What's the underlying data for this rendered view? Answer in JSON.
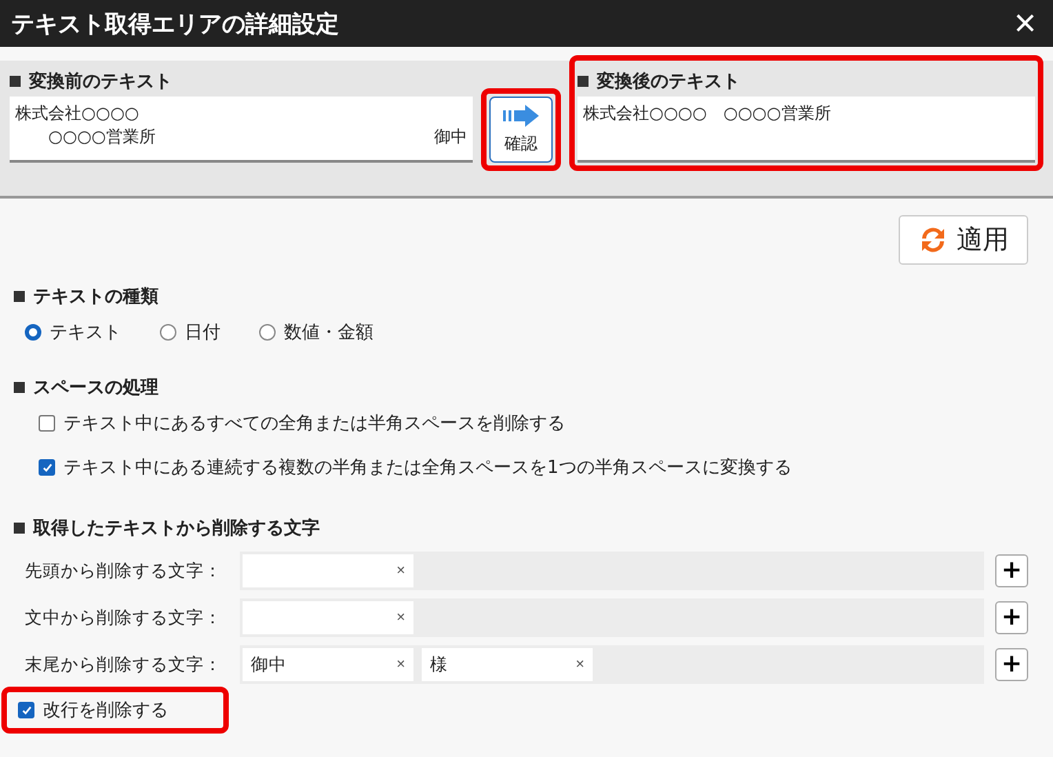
{
  "window": {
    "title": "テキスト取得エリアの詳細設定",
    "close": "×"
  },
  "before": {
    "heading": "変換前のテキスト",
    "lines": [
      {
        "text": "株式会社○○○○"
      },
      {
        "text": "　　○○○○営業所",
        "right": "御中"
      }
    ]
  },
  "confirm": {
    "label": "確認",
    "highlighted": true
  },
  "after": {
    "heading": "変換後のテキスト",
    "text": "株式会社○○○○　○○○○営業所",
    "highlighted": true
  },
  "apply": {
    "label": "適用"
  },
  "text_type": {
    "heading": "テキストの種類",
    "options": [
      {
        "label": "テキスト",
        "selected": true
      },
      {
        "label": "日付",
        "selected": false
      },
      {
        "label": "数値・金額",
        "selected": false
      }
    ]
  },
  "spaces": {
    "heading": "スペースの処理",
    "options": [
      {
        "label": "テキスト中にあるすべての全角または半角スペースを削除する",
        "checked": false
      },
      {
        "label": "テキスト中にある連続する複数の半角または全角スペースを1つの半角スペースに変換する",
        "checked": true
      }
    ]
  },
  "remove_chars": {
    "heading": "取得したテキストから削除する文字",
    "rows": [
      {
        "label": "先頭から削除する文字：",
        "chips": [
          {
            "kind": "empty"
          }
        ]
      },
      {
        "label": "文中から削除する文字：",
        "chips": [
          {
            "kind": "empty"
          }
        ]
      },
      {
        "label": "末尾から削除する文字：",
        "chips": [
          {
            "kind": "text",
            "text": "御中"
          },
          {
            "kind": "text",
            "text": "様"
          }
        ]
      }
    ],
    "chip_remove": "×",
    "add": "+"
  },
  "remove_newline": {
    "label": "改行を削除する",
    "checked": true,
    "highlighted": true
  }
}
